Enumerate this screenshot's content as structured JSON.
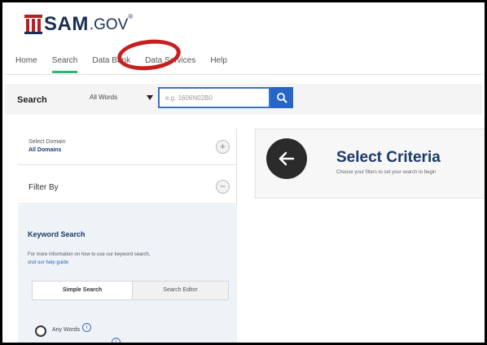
{
  "logo": {
    "sam": "SAM",
    "gov": ".GOV",
    "reg": "®"
  },
  "nav": {
    "items": [
      {
        "label": "Home"
      },
      {
        "label": "Search"
      },
      {
        "label": "Data Bank"
      },
      {
        "label": "Data Services"
      },
      {
        "label": "Help"
      }
    ]
  },
  "search": {
    "label": "Search",
    "select_value": "All Words",
    "placeholder": "e.g. 1606N02B0"
  },
  "sidebar": {
    "domain_title": "Select Domain",
    "domain_value": "All Domains",
    "filter_label": "Filter By",
    "keyword": {
      "title": "Keyword Search",
      "description": "For more information on how to use our keyword search,",
      "link": "visit our help guide",
      "tab_simple": "Simple Search",
      "tab_editor": "Search Editor",
      "any_words": "Any Words"
    }
  },
  "main": {
    "criteria_title": "Select Criteria",
    "criteria_subtitle": "Choose your filters to set your search to begin"
  },
  "colors": {
    "brand_navy": "#1a2f56",
    "brand_red": "#b61f24",
    "accent_blue": "#2566c7",
    "active_green": "#2bb673",
    "annotation_red": "#c61f1f"
  }
}
